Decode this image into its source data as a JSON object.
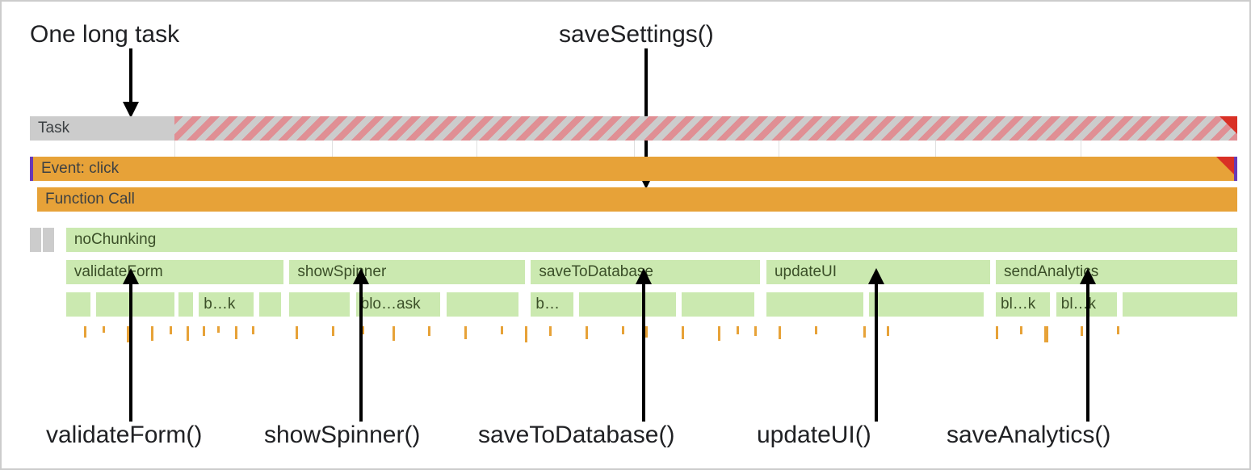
{
  "labels": {
    "topLeft": "One long task",
    "topRight": "saveSettings()",
    "bottom1": "validateForm()",
    "bottom2": "showSpinner()",
    "bottom3": "saveToDatabase()",
    "bottom4": "updateUI()",
    "bottom5": "saveAnalytics()"
  },
  "bars": {
    "task": "Task",
    "event": "Event: click",
    "fcall": "Function Call",
    "noChunk": "noChunking",
    "row2": {
      "validateForm": "validateForm",
      "showSpinner": "showSpinner",
      "saveToDatabase": "saveToDatabase",
      "updateUI": "updateUI",
      "sendAnalytics": "sendAnalytics"
    },
    "row3": {
      "b1": "b…k",
      "b2": "blo…ask",
      "b3": "b…",
      "b4": "bl…k",
      "b5": "bl…k"
    }
  },
  "colors": {
    "task_gray": "#cccccc",
    "task_stripe": "#e08f94",
    "event_orange": "#e7a238",
    "green": "#cbe9b0",
    "red_corner": "#d93025",
    "purple_edge": "#673ab7"
  }
}
